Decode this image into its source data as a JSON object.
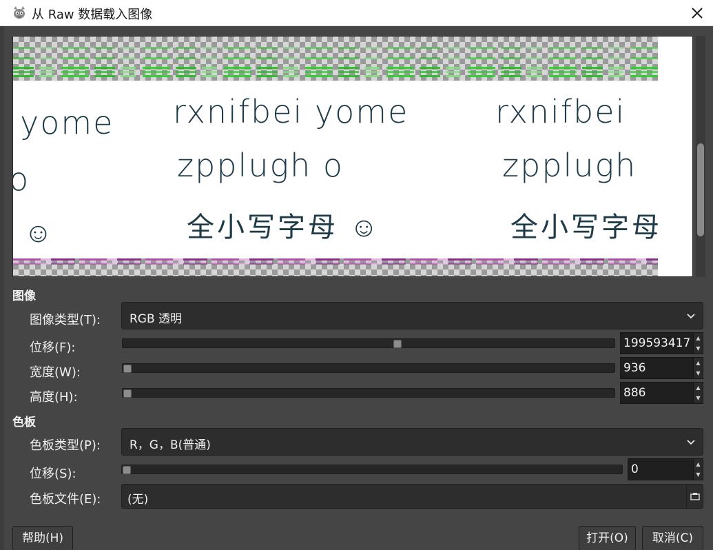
{
  "window": {
    "title": "从 Raw 数据载入图像"
  },
  "preview": {
    "line1_a": "yome",
    "line1_b": "rxnifbei yome",
    "line1_c": "rxnifbei",
    "line2_a": "o",
    "line2_b": "zpplugh o",
    "line2_c": "zpplugh",
    "line3_a": "☺",
    "line3_b": "全小写字母 ☺",
    "line3_c": "全小写字母"
  },
  "image_section": {
    "title": "图像",
    "type_label": "图像类型(T):",
    "type_value": "RGB 透明",
    "offset_label": "位移(F):",
    "offset_value": "199593417",
    "offset_level": 0.56,
    "width_label": "宽度(W):",
    "width_value": "936",
    "width_level": 0.0,
    "height_label": "高度(H):",
    "height_value": "886",
    "height_level": 0.0
  },
  "palette_section": {
    "title": "色板",
    "type_label": "色板类型(P):",
    "type_value": "R，G，B(普通)",
    "offset_label": "位移(S):",
    "offset_value": "0",
    "offset_level": 0.0,
    "file_label": "色板文件(E):",
    "file_value": "(无)"
  },
  "buttons": {
    "help": "帮助(H)",
    "open": "打开(O)",
    "cancel": "取消(C)"
  },
  "icons": [
    "gimp-icon",
    "close-icon",
    "chevron-down-icon",
    "spin-up-icon",
    "spin-down-icon",
    "file-open-icon"
  ]
}
